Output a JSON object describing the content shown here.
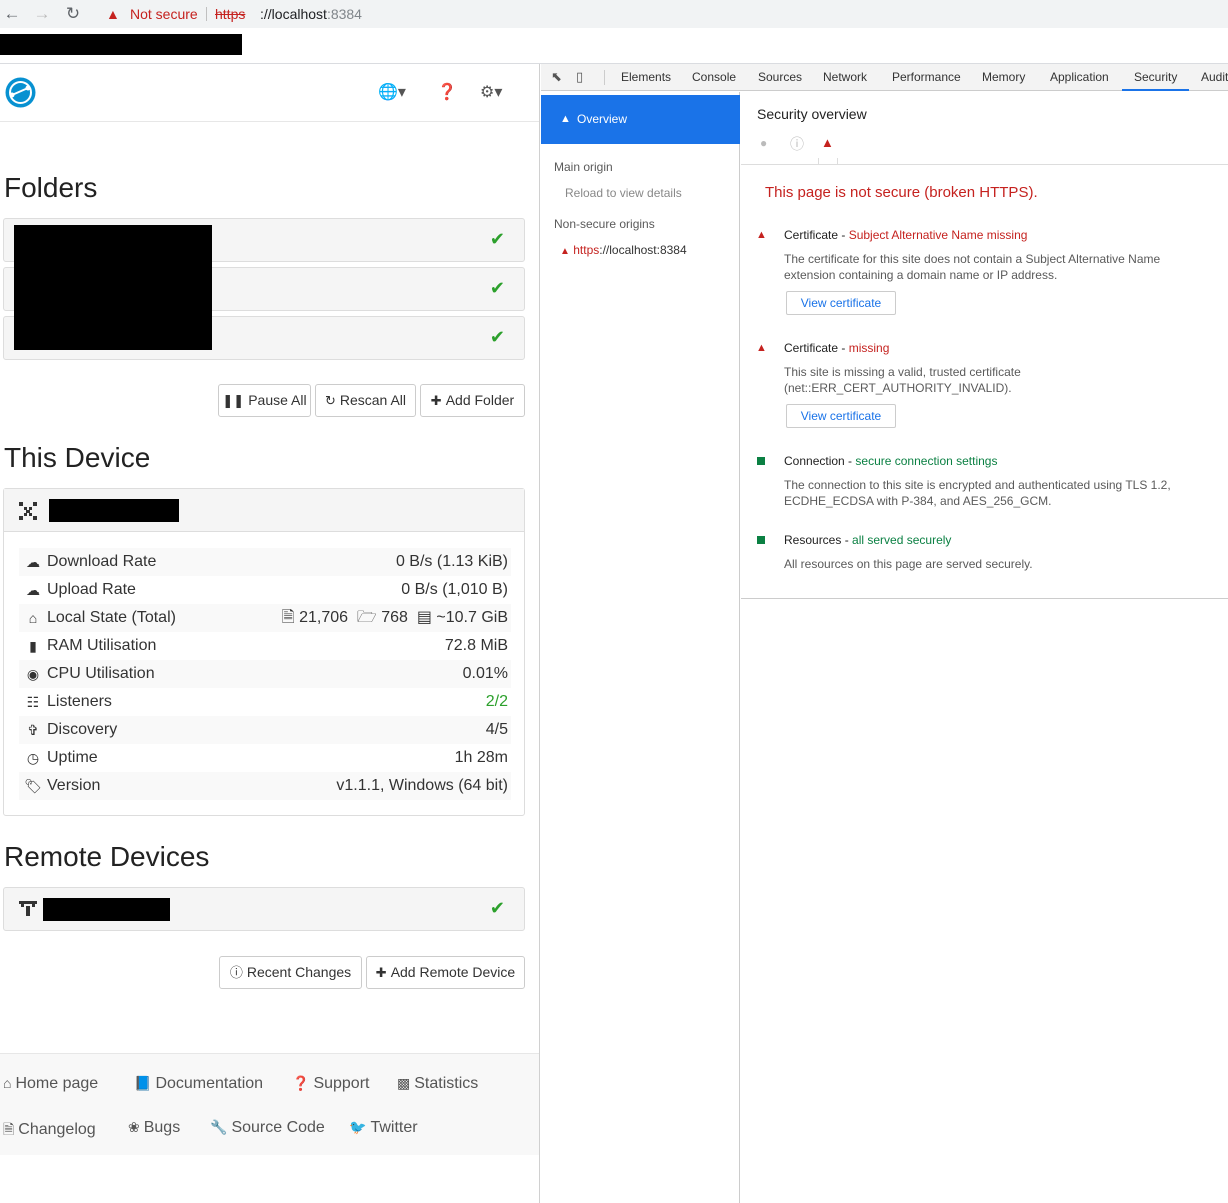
{
  "browser": {
    "url_security_label": "Not secure",
    "url_scheme": "https",
    "url_sep": "://",
    "url_host": "localhost",
    "url_port": ":8384"
  },
  "app": {
    "sections": {
      "folders": "Folders",
      "this_device": "This Device",
      "remote_devices": "Remote Devices"
    },
    "folder_buttons": {
      "pause": "Pause All",
      "rescan": "Rescan All",
      "add": "Add Folder"
    },
    "device_stats": [
      {
        "icon": "cloud-download-icon",
        "label": "Download Rate",
        "value": "0 B/s (1.13 KiB)"
      },
      {
        "icon": "cloud-upload-icon",
        "label": "Upload Rate",
        "value": "0 B/s (1,010 B)"
      },
      {
        "icon": "home-icon",
        "label": "Local State (Total)",
        "files": "21,706",
        "dirs": "768",
        "size": "~10.7 GiB"
      },
      {
        "icon": "memory-icon",
        "label": "RAM Utilisation",
        "value": "72.8 MiB"
      },
      {
        "icon": "dashboard-icon",
        "label": "CPU Utilisation",
        "value": "0.01%"
      },
      {
        "icon": "sitemap-icon",
        "label": "Listeners",
        "value": "2/2"
      },
      {
        "icon": "signpost-icon",
        "label": "Discovery",
        "value": "4/5"
      },
      {
        "icon": "clock-icon",
        "label": "Uptime",
        "value": "1h 28m"
      },
      {
        "icon": "tag-icon",
        "label": "Version",
        "value": "v1.1.1, Windows (64 bit)"
      }
    ],
    "remote_buttons": {
      "recent": "Recent Changes",
      "add": "Add Remote Device"
    },
    "footer_links": {
      "home": "Home page",
      "docs": "Documentation",
      "support": "Support",
      "stats": "Statistics",
      "changelog": "Changelog",
      "bugs": "Bugs",
      "source": "Source Code",
      "twitter": "Twitter"
    },
    "colors": {
      "ok_green": "#2ca02c"
    }
  },
  "devtools": {
    "tabs": [
      "Elements",
      "Console",
      "Sources",
      "Network",
      "Performance",
      "Memory",
      "Application",
      "Security",
      "Audits"
    ],
    "active_tab": "Security",
    "sidebar": {
      "overview": "Overview",
      "main_origin": "Main origin",
      "reload": "Reload to view details",
      "non_secure": "Non-secure origins",
      "origin_scheme": "https",
      "origin_rest": "://localhost:8384"
    },
    "main": {
      "title": "Security overview",
      "summary": "This page is not secure (broken HTTPS).",
      "items": [
        {
          "title": "Certificate",
          "sep": " - ",
          "status": "Subject Alternative Name missing",
          "body": "The certificate for this site does not contain a Subject Alternative Name extension containing a domain name or IP address.",
          "button": "View certificate"
        },
        {
          "title": "Certificate",
          "sep": " - ",
          "status": "missing",
          "body": "This site is missing a valid, trusted certificate (net::ERR_CERT_AUTHORITY_INVALID).",
          "button": "View certificate"
        },
        {
          "title": "Connection",
          "sep": " - ",
          "status": "secure connection settings",
          "body": "The connection to this site is encrypted and authenticated using TLS 1.2, ECDHE_ECDSA with P-384, and AES_256_GCM."
        },
        {
          "title": "Resources",
          "sep": " - ",
          "status": "all served securely",
          "body": "All resources on this page are served securely."
        }
      ]
    },
    "colors": {
      "active_blue": "#1a73e8",
      "warning_red": "#c5221f",
      "secure_green": "#0b8043"
    }
  }
}
